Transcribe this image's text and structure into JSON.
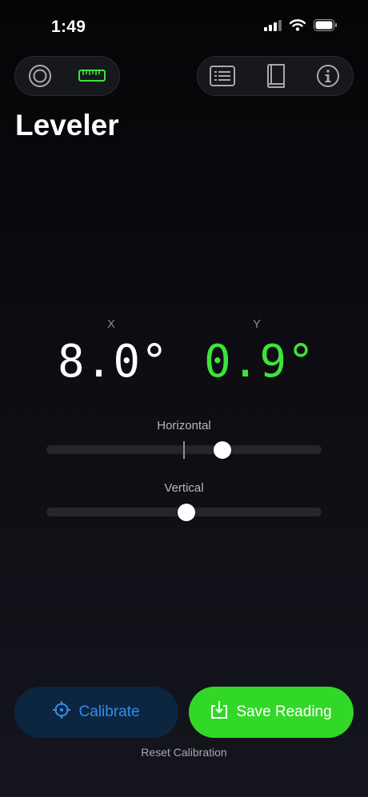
{
  "status_bar": {
    "time": "1:49",
    "icons": [
      "cellular-signal-icon",
      "wifi-icon",
      "battery-icon"
    ]
  },
  "toolbar_left": {
    "icons": [
      "bubble-level-icon",
      "ruler-icon"
    ],
    "active": "ruler-icon",
    "active_color": "#3ce43a"
  },
  "toolbar_right": {
    "icons": [
      "list-icon",
      "book-icon",
      "info-icon"
    ]
  },
  "page_title": "Leveler",
  "readings": {
    "x_label": "X",
    "x_value": "8.0°",
    "y_label": "Y",
    "y_value": "0.9°",
    "y_color": "#3ce43a"
  },
  "sliders": {
    "horizontal": {
      "label": "Horizontal",
      "level_fraction": 0.64
    },
    "vertical": {
      "label": "Vertical",
      "level_fraction": 0.51
    }
  },
  "buttons": {
    "calibrate_label": "Calibrate",
    "calibrate_color": "#2f8ef0",
    "save_label": "Save Reading",
    "save_color": "#32d827",
    "reset_label": "Reset Calibration"
  }
}
